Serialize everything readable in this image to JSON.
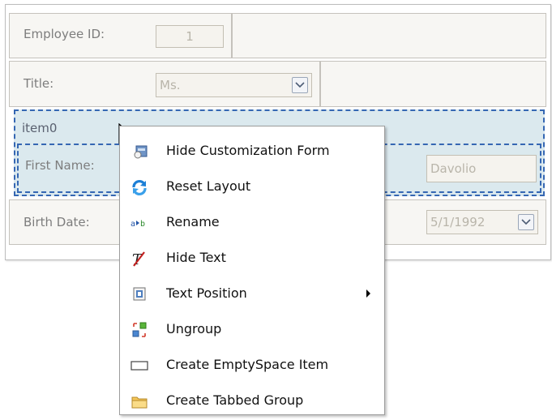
{
  "form": {
    "employee_id_label": "Employee ID:",
    "employee_id_value": "1",
    "title_label": "Title:",
    "title_value": "Ms.",
    "group_caption": "item0",
    "first_name_label": "First Name:",
    "first_name_value": "Davolio",
    "birth_date_label": "Birth Date:",
    "birth_date_value": "5/1/1992"
  },
  "context_menu": {
    "items": [
      {
        "label": "Hide Customization Form",
        "icon": "hide-customization-icon"
      },
      {
        "label": "Reset Layout",
        "icon": "reset-layout-icon"
      },
      {
        "label": "Rename",
        "icon": "rename-icon"
      },
      {
        "label": "Hide Text",
        "icon": "hide-text-icon"
      },
      {
        "label": "Text Position",
        "icon": "text-position-icon",
        "submenu": true
      },
      {
        "label": "Ungroup",
        "icon": "ungroup-icon"
      },
      {
        "label": "Create EmptySpace Item",
        "icon": "empty-space-icon"
      },
      {
        "label": "Create Tabbed Group",
        "icon": "tabbed-group-icon"
      }
    ]
  },
  "colors": {
    "group_fill": "#dbe9ee",
    "group_border": "#3567b3",
    "cell_fill": "#f7f6f3",
    "disabled_text": "#b9b5aa"
  }
}
